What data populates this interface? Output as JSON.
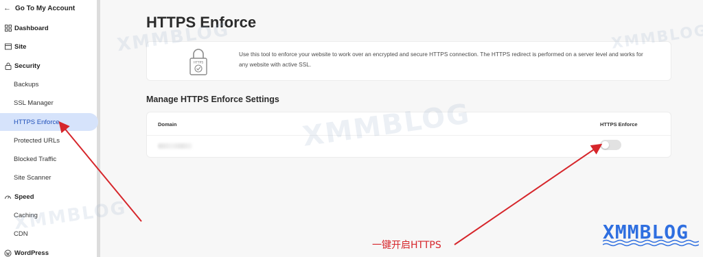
{
  "sidebar": {
    "back_label": "Go To My Account",
    "items": [
      {
        "label": "Dashboard",
        "type": "section",
        "icon": "grid-icon"
      },
      {
        "label": "Site",
        "type": "section",
        "icon": "site-icon"
      },
      {
        "label": "Security",
        "type": "section",
        "icon": "lock-icon"
      },
      {
        "label": "Backups",
        "type": "sub"
      },
      {
        "label": "SSL Manager",
        "type": "sub"
      },
      {
        "label": "HTTPS Enforce",
        "type": "sub",
        "active": true
      },
      {
        "label": "Protected URLs",
        "type": "sub"
      },
      {
        "label": "Blocked Traffic",
        "type": "sub"
      },
      {
        "label": "Site Scanner",
        "type": "sub"
      },
      {
        "label": "Speed",
        "type": "section",
        "icon": "speed-icon"
      },
      {
        "label": "Caching",
        "type": "sub"
      },
      {
        "label": "CDN",
        "type": "sub"
      },
      {
        "label": "WordPress",
        "type": "section",
        "icon": "wordpress-icon"
      }
    ]
  },
  "main": {
    "title": "HTTPS Enforce",
    "info": {
      "icon_label": "HTTPS",
      "description": "Use this tool to enforce your website to work over an encrypted and secure HTTPS connection. The HTTPS redirect is performed on a server level and works for any website with active SSL."
    },
    "settings": {
      "title": "Manage HTTPS Enforce Settings",
      "col_domain": "Domain",
      "col_enforce": "HTTPS Enforce",
      "rows": [
        {
          "enforce_enabled": false
        }
      ]
    }
  },
  "annotation": {
    "text": "一键开启HTTPS",
    "color": "#d6262b"
  },
  "watermark": {
    "text": "XMMBLOG",
    "color": "#2f6fe0"
  },
  "colors": {
    "active_bg": "#d6e3fb",
    "active_text": "#1f4fb8",
    "toggle_off": "#e2e2e2"
  }
}
